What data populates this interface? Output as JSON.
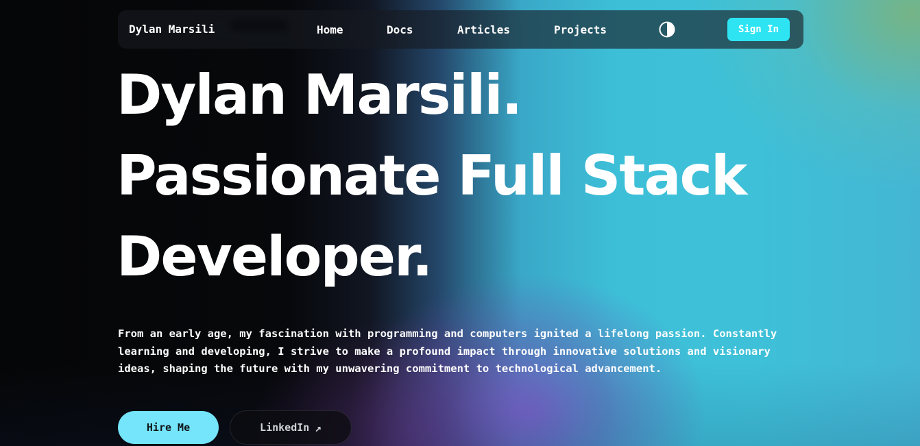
{
  "nav": {
    "brand": "Dylan Marsili",
    "links": [
      {
        "label": "Home"
      },
      {
        "label": "Docs"
      },
      {
        "label": "Articles"
      },
      {
        "label": "Projects"
      }
    ],
    "theme_toggle_icon": "contrast-icon",
    "signin_label": "Sign In",
    "signin_color": "#2ee4f3"
  },
  "hero": {
    "headline": [
      "Dylan Marsili.",
      "Passionate Full Stack",
      "Developer."
    ],
    "intro_lines": [
      "From an early age, my fascination with programming and computers ignited a lifelong passion. Constantly",
      "learning and developing, I strive to make a profound impact through innovative solutions and visionary",
      "ideas, shaping the future with my unwavering commitment to technological advancement."
    ],
    "primary_cta": "Hire Me",
    "secondary_cta": "LinkedIn",
    "secondary_cta_icon": "external-arrow-icon",
    "accent_color": "#74e5fb"
  }
}
